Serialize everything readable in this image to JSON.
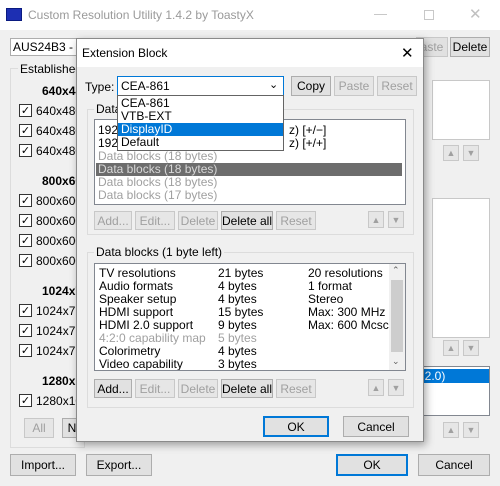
{
  "main": {
    "title": "Custom Resolution Utility 1.4.2 by ToastyX",
    "monitor_select": "AUS24B3 - X(",
    "top_buttons": [
      "aste",
      "Delete"
    ],
    "established_label": "Established",
    "groups": [
      {
        "title": "640x48",
        "items": [
          "640x480",
          "640x480",
          "640x480"
        ]
      },
      {
        "title": "800x60",
        "items": [
          "800x600",
          "800x600",
          "800x600",
          "800x600"
        ]
      },
      {
        "title": "1024x7",
        "items": [
          "1024x76",
          "1024x76",
          "1024x76"
        ]
      },
      {
        "title": "1280x1",
        "items": [
          "1280x10"
        ]
      }
    ],
    "all_label": "All",
    "none_label": "N",
    "import_label": "Import...",
    "export_label": "Export...",
    "ok_label": "OK",
    "cancel_label": "Cancel",
    "right_list_partial": "MI 2.0)"
  },
  "dialog": {
    "title": "Extension Block",
    "type_label": "Type:",
    "type_value": "CEA-861",
    "type_options": [
      "CEA-861",
      "VTB-EXT",
      "DisplayID",
      "Default"
    ],
    "type_selected_index": 2,
    "copy_label": "Copy",
    "paste_label": "Paste",
    "reset_label": "Reset",
    "data_label_partial": "Data",
    "detailed_rows": [
      {
        "left": "192",
        "right": "z) [+/−]"
      },
      {
        "left": "192",
        "right": "z) [+/+]"
      }
    ],
    "block_rows": [
      {
        "text": "Data blocks (18 bytes)",
        "selected": false
      },
      {
        "text": "Data blocks (18 bytes)",
        "selected": true
      },
      {
        "text": "Data blocks (18 bytes)",
        "selected": false
      },
      {
        "text": "Data blocks (17 bytes)",
        "selected": false
      }
    ],
    "list_buttons": {
      "add": "Add...",
      "edit": "Edit...",
      "delete": "Delete",
      "delete_all": "Delete all",
      "reset": "Reset"
    },
    "data_blocks_title": "Data blocks (1 byte left)",
    "data_blocks": [
      {
        "name": "TV resolutions",
        "bytes": "21 bytes",
        "info": "20 resolutions",
        "disabled": false
      },
      {
        "name": "Audio formats",
        "bytes": "4 bytes",
        "info": "1 format",
        "disabled": false
      },
      {
        "name": "Speaker setup",
        "bytes": "4 bytes",
        "info": "Stereo",
        "disabled": false
      },
      {
        "name": "HDMI support",
        "bytes": "15 bytes",
        "info": "Max: 300 MHz",
        "disabled": false
      },
      {
        "name": "HDMI 2.0 support",
        "bytes": "9 bytes",
        "info": "Max: 600 Mcsc",
        "disabled": false
      },
      {
        "name": "4:2:0 capability map",
        "bytes": "5 bytes",
        "info": "",
        "disabled": true
      },
      {
        "name": "Colorimetry",
        "bytes": "4 bytes",
        "info": "",
        "disabled": false
      },
      {
        "name": "Video capability",
        "bytes": "3 bytes",
        "info": "",
        "disabled": false
      }
    ],
    "ok_label": "OK",
    "cancel_label": "Cancel"
  }
}
